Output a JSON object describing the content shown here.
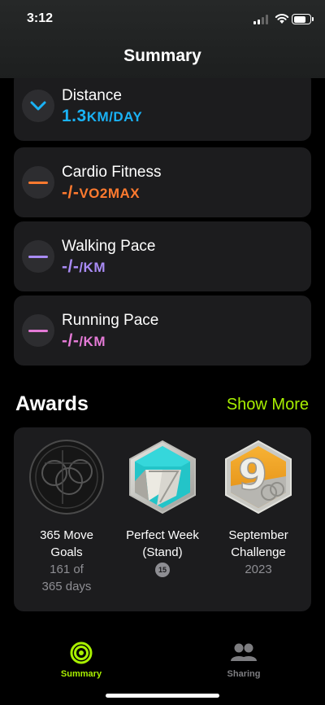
{
  "status": {
    "time": "3:12"
  },
  "header": {
    "title": "Summary"
  },
  "metrics": [
    {
      "label": "Distance",
      "value": "1.3",
      "unit": "KM/DAY",
      "color": "#1ab2f5",
      "indicator": "chevron-down-icon"
    },
    {
      "label": "Cardio Fitness",
      "value": "-/-",
      "unit": "VO2MAX",
      "color": "#ff7a2f",
      "indicator": "dash"
    },
    {
      "label": "Walking Pace",
      "value": "-/-",
      "unit": "/KM",
      "color": "#a98bf5",
      "indicator": "dash"
    },
    {
      "label": "Running Pace",
      "value": "-/-",
      "unit": "/KM",
      "color": "#e47ad6",
      "indicator": "dash"
    }
  ],
  "awards": {
    "title": "Awards",
    "show_more": "Show More",
    "items": [
      {
        "name_line1": "365 Move",
        "name_line2": "Goals",
        "sub_line1": "161 of",
        "sub_line2": "365 days"
      },
      {
        "name_line1": "Perfect Week",
        "name_line2": "(Stand)",
        "count": "15"
      },
      {
        "name_line1": "September",
        "name_line2": "Challenge",
        "sub_line1": "2023",
        "badge_number": "9"
      }
    ]
  },
  "tabbar": {
    "tabs": [
      {
        "label": "Summary",
        "icon": "activity-rings-icon",
        "active": true
      },
      {
        "label": "Sharing",
        "icon": "people-icon",
        "active": false
      }
    ]
  },
  "colors": {
    "accent": "#a8f000",
    "card": "#1c1c1e"
  }
}
